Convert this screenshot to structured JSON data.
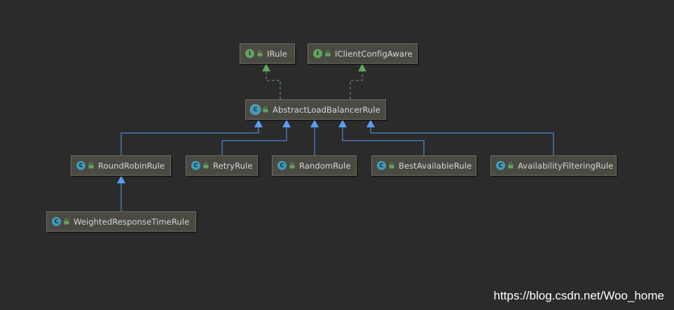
{
  "nodes": {
    "irule": {
      "kind": "I",
      "label": "IRule"
    },
    "iclientconfigaware": {
      "kind": "I",
      "label": "IClientConfigAware"
    },
    "abstractloadbalancerrule": {
      "kind": "C",
      "label": "AbstractLoadBalancerRule"
    },
    "roundrobinrule": {
      "kind": "C",
      "label": "RoundRobinRule"
    },
    "retryrule": {
      "kind": "C",
      "label": "RetryRule"
    },
    "randomrule": {
      "kind": "C",
      "label": "RandomRule"
    },
    "bestavailablerule": {
      "kind": "C",
      "label": "BestAvailableRule"
    },
    "availabilityfilteringrule": {
      "kind": "C",
      "label": "AvailabilityFilteringRule"
    },
    "weightedresponsetimerule": {
      "kind": "C",
      "label": "WeightedResponseTimeRule"
    }
  },
  "relations": [
    {
      "from": "abstractloadbalancerrule",
      "to": "irule",
      "type": "implements"
    },
    {
      "from": "abstractloadbalancerrule",
      "to": "iclientconfigaware",
      "type": "implements"
    },
    {
      "from": "roundrobinrule",
      "to": "abstractloadbalancerrule",
      "type": "extends"
    },
    {
      "from": "retryrule",
      "to": "abstractloadbalancerrule",
      "type": "extends"
    },
    {
      "from": "randomrule",
      "to": "abstractloadbalancerrule",
      "type": "extends"
    },
    {
      "from": "bestavailablerule",
      "to": "abstractloadbalancerrule",
      "type": "extends"
    },
    {
      "from": "availabilityfilteringrule",
      "to": "abstractloadbalancerrule",
      "type": "extends"
    },
    {
      "from": "weightedresponsetimerule",
      "to": "roundrobinrule",
      "type": "extends"
    }
  ],
  "colors": {
    "background": "#2b2b2b",
    "implements_edge": "#62a35f",
    "extends_edge": "#589df6"
  },
  "watermark": "https://blog.csdn.net/Woo_home"
}
